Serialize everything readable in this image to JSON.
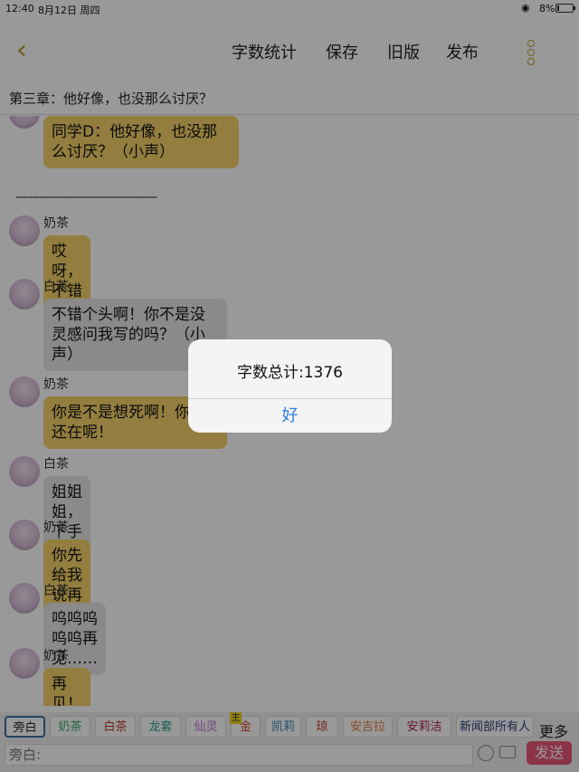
{
  "status_bar": {
    "time": "12:40",
    "date": "8月12日 周四",
    "battery": "8%"
  },
  "nav": {
    "items": [
      "字数统计",
      "保存",
      "旧版",
      "发布"
    ]
  },
  "chapter_title": "第三章：他好像，也没那么讨厌？",
  "separator": "————————————",
  "messages": [
    {
      "name": "",
      "text": "同学D：他好像，也没那么讨厌？（小声）",
      "color": "yellow"
    },
    {
      "name": "奶茶",
      "text": "哎呀，不错不错",
      "color": "yellow"
    },
    {
      "name": "白茶",
      "text": "不错个头啊！你不是没灵感问我写的吗？（小声）",
      "color": "gray"
    },
    {
      "name": "奶茶",
      "text": "你是不是想死啊！你我还在呢！",
      "color": "yellow"
    },
    {
      "name": "白茶",
      "text": "姐姐姐，下手轻点啊！",
      "color": "gray"
    },
    {
      "name": "奶茶",
      "text": "你先给我说再见再走！",
      "color": "yellow"
    },
    {
      "name": "白茶",
      "text": "呜呜呜呜呜再见……",
      "color": "gray"
    },
    {
      "name": "奶茶",
      "text": "再见！你给我过来！",
      "color": "yellow"
    }
  ],
  "alert": {
    "message": "字数总计:1376",
    "ok": "好"
  },
  "characters": [
    {
      "label": "旁白",
      "color": "#222222"
    },
    {
      "label": "奶茶",
      "color": "#3aa86b"
    },
    {
      "label": "白茶",
      "color": "#c0392b"
    },
    {
      "label": "龙套",
      "color": "#2a9d8f"
    },
    {
      "label": "仙灵",
      "color": "#c06fd0"
    },
    {
      "label": "金",
      "color": "#d4442c"
    },
    {
      "label": "凯莉",
      "color": "#3c8dbc"
    },
    {
      "label": "琼",
      "color": "#c0392b"
    },
    {
      "label": "安吉拉",
      "color": "#e07b3a"
    },
    {
      "label": "安莉洁",
      "color": "#b0235c"
    },
    {
      "label": "新闻部所有人",
      "color": "#2c3e7a"
    }
  ],
  "crown_label": "主",
  "more_label": "更多",
  "input": {
    "placeholder": "旁白:"
  },
  "send_label": "发送"
}
